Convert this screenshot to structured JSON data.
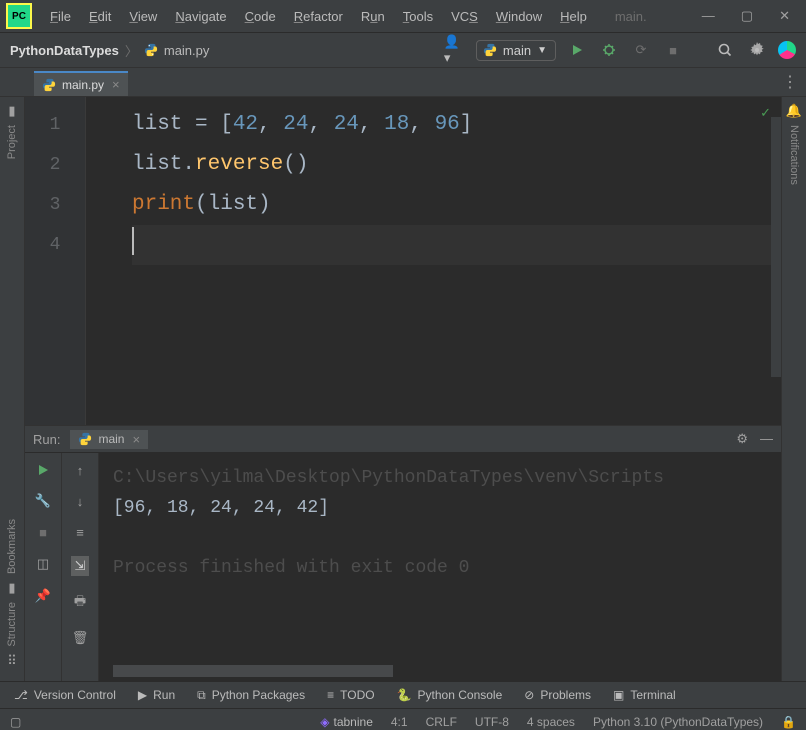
{
  "titlebar": {
    "menu": {
      "file": "File",
      "edit": "Edit",
      "view": "View",
      "navigate": "Navigate",
      "code": "Code",
      "refactor": "Refactor",
      "run": "Run",
      "tools": "Tools",
      "vcs": "VCS",
      "window": "Window",
      "help": "Help"
    },
    "context": "main."
  },
  "breadcrumb": {
    "project": "PythonDataTypes",
    "file": "main.py"
  },
  "run_config": {
    "label": "main"
  },
  "tabs": [
    {
      "label": "main.py"
    }
  ],
  "sidebar_left": {
    "project": "Project",
    "bookmarks": "Bookmarks",
    "structure": "Structure"
  },
  "sidebar_right": {
    "notifications": "Notifications"
  },
  "editor": {
    "line_numbers": [
      "1",
      "2",
      "3",
      "4"
    ],
    "lines": {
      "l1": {
        "a": "list ",
        "b": "= [",
        "n1": "42",
        "c": ", ",
        "n2": "24",
        "n3": "24",
        "n4": "18",
        "n5": "96",
        "d": "]"
      },
      "l2": {
        "a": "list.",
        "fn": "reverse",
        "b": "()"
      },
      "l3": {
        "kw": "print",
        "a": "(list)"
      }
    }
  },
  "run_panel": {
    "title": "Run:",
    "tab": "main",
    "out_path": "C:\\Users\\yilma\\Desktop\\PythonDataTypes\\venv\\Scripts",
    "out_result": "[96, 18, 24, 24, 42]",
    "out_exit": "Process finished with exit code 0"
  },
  "bottom_tools": {
    "version_control": "Version Control",
    "run": "Run",
    "packages": "Python Packages",
    "todo": "TODO",
    "console": "Python Console",
    "problems": "Problems",
    "terminal": "Terminal"
  },
  "status": {
    "tabnine": "tabnine",
    "pos": "4:1",
    "eol": "CRLF",
    "enc": "UTF-8",
    "indent": "4 spaces",
    "interpreter": "Python 3.10 (PythonDataTypes)"
  }
}
